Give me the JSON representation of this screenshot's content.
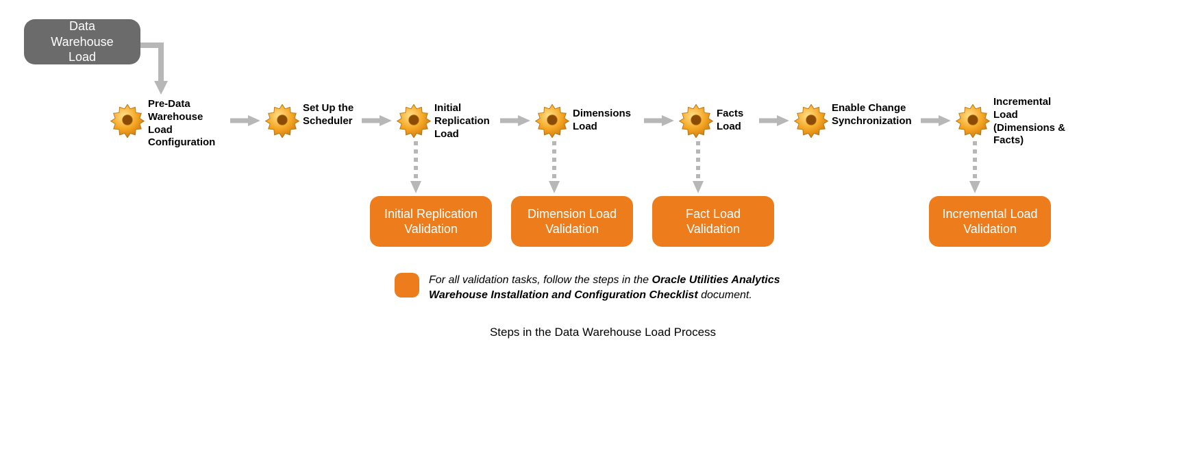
{
  "header": {
    "title": "Data Warehouse Load"
  },
  "steps": [
    {
      "label": "Pre-Data Warehouse Load Configuration"
    },
    {
      "label": "Set Up the Scheduler"
    },
    {
      "label": "Initial Replication Load"
    },
    {
      "label": "Dimensions Load"
    },
    {
      "label": "Facts Load"
    },
    {
      "label": "Enable Change Synchronization"
    },
    {
      "label": "Incremental Load (Dimensions & Facts)"
    }
  ],
  "validations": [
    {
      "label": "Initial Replication Validation"
    },
    {
      "label": "Dimension Load Validation"
    },
    {
      "label": "Fact Load Validation"
    },
    {
      "label": "Incremental Load Validation"
    }
  ],
  "legend": {
    "prefix": "For all validation tasks, follow the steps in the ",
    "bold": "Oracle Utilities Analytics Warehouse Installation and Configuration Checklist",
    "suffix": " document."
  },
  "caption": "Steps in the Data Warehouse Load Process",
  "colors": {
    "accent": "#ec7c1c",
    "header": "#6b6b6b",
    "arrow": "#b7b7b7"
  }
}
